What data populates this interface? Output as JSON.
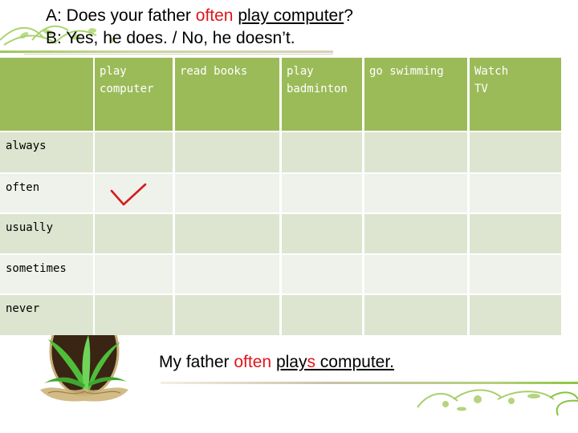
{
  "dialogue": {
    "line_a": {
      "prefix": "A: Does your father ",
      "frequency": "often",
      "space": " ",
      "activity": "play computer",
      "suffix": "?"
    },
    "line_b": "B: Yes, he does. / No, he doesn’t."
  },
  "table": {
    "corner": "",
    "columns": [
      "play computer",
      "read books",
      "play badminton",
      "go swimming",
      "Watch TV"
    ],
    "rows": [
      {
        "label": "always",
        "checks": [
          false,
          false,
          false,
          false,
          false
        ]
      },
      {
        "label": "often",
        "checks": [
          true,
          false,
          false,
          false,
          false
        ]
      },
      {
        "label": "usually",
        "checks": [
          false,
          false,
          false,
          false,
          false
        ]
      },
      {
        "label": "sometimes",
        "checks": [
          false,
          false,
          false,
          false,
          false
        ]
      },
      {
        "label": "never",
        "checks": [
          false,
          false,
          false,
          false,
          false
        ]
      }
    ],
    "check_symbol": "check-mark",
    "colors": {
      "header": "#9BBB59",
      "row_odd": "#DDE5D0",
      "row_even": "#EFF2EA",
      "check": "#D7191E"
    }
  },
  "answer": {
    "prefix": "My father ",
    "frequency": "often",
    "space": " ",
    "verb_base": "play",
    "verb_suffix": "s",
    "rest": " computer."
  },
  "accent_color": "#E0151B"
}
